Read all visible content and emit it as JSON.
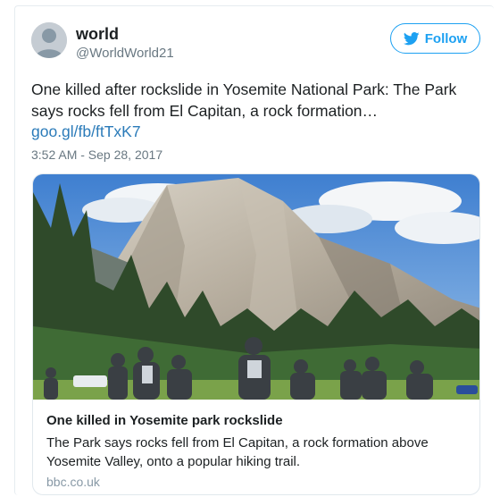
{
  "user": {
    "name": "world",
    "handle": "@WorldWorld21",
    "avatar_icon": "default-profile-icon"
  },
  "follow_button": {
    "label": "Follow",
    "icon": "twitter-bird-icon",
    "color": "#1da1f2"
  },
  "tweet": {
    "text": "One killed after rockslide in Yosemite National Park: The Park says rocks fell from El Capitan, a rock formation…",
    "link": "goo.gl/fb/ftTxK7",
    "timestamp": "3:52 AM - Sep 28, 2017"
  },
  "card": {
    "image_description_icon": "el-capitan-photo",
    "title": "One killed in Yosemite park rockslide",
    "description": "The Park says rocks fell from El Capitan, a rock formation above Yosemite Valley, onto a popular hiking trail.",
    "domain": "bbc.co.uk"
  },
  "colors": {
    "link": "#2b7bb9",
    "muted": "#697882",
    "text": "#1c2022"
  }
}
